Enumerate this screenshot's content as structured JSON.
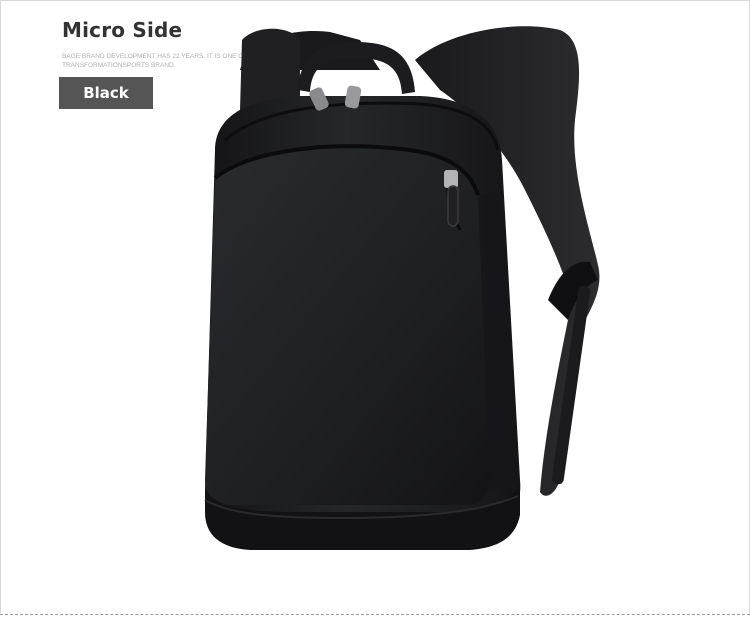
{
  "header": {
    "title": "Micro Side",
    "subtitle": "BAGE BRAND DEVELOPMENT HAS 22 YEARS. IT IS ONE OF IN TRANSFORMATIONSPORTS BRAND.",
    "color_label": "Black"
  },
  "product": {
    "name": "backpack",
    "color": "#1f1f21"
  }
}
